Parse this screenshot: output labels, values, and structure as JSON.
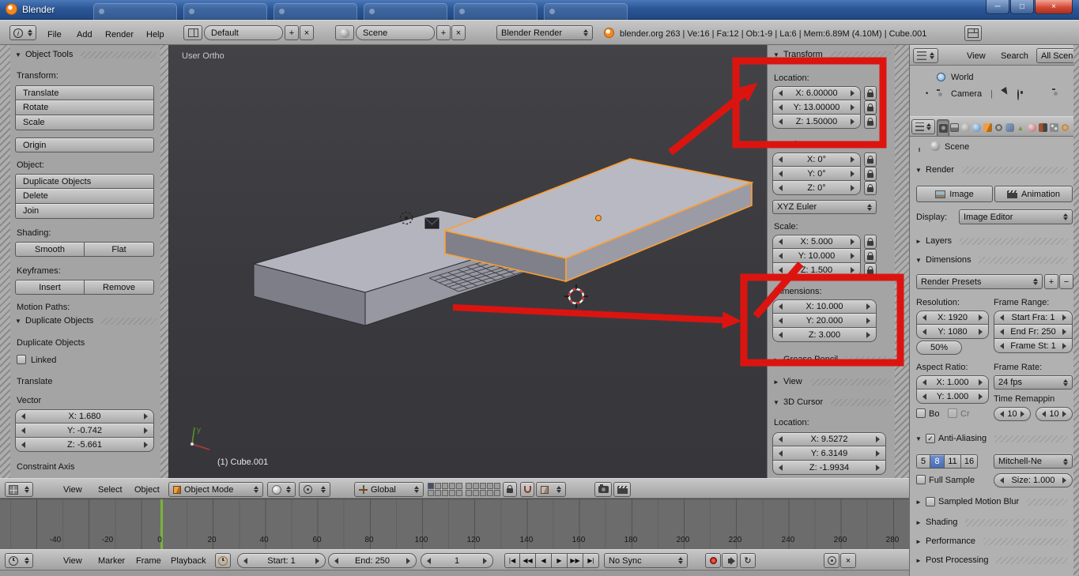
{
  "window": {
    "title": "Blender",
    "minimize": "─",
    "maximize": "□",
    "close": "×"
  },
  "info": {
    "menu_file": "File",
    "menu_add": "Add",
    "menu_render": "Render",
    "menu_help": "Help",
    "layout": "Default",
    "scene": "Scene",
    "engine": "Blender Render",
    "stats": "blender.org 263 | Ve:16 | Fa:12 | Ob:1-9 | La:6 | Mem:6.89M (4.10M) | Cube.001"
  },
  "tools": {
    "title": "Object Tools",
    "transform_label": "Transform:",
    "translate": "Translate",
    "rotate": "Rotate",
    "scale": "Scale",
    "origin": "Origin",
    "object_label": "Object:",
    "duplicate": "Duplicate Objects",
    "delete": "Delete",
    "join": "Join",
    "shading_label": "Shading:",
    "smooth": "Smooth",
    "flat": "Flat",
    "keyframes_label": "Keyframes:",
    "insert": "Insert",
    "remove": "Remove",
    "motion_paths_label": "Motion Paths:",
    "dup_panel_title": "Duplicate Objects",
    "dup_label": "Duplicate Objects",
    "linked": "Linked",
    "translate_label": "Translate",
    "vector_label": "Vector",
    "vx": "X: 1.680",
    "vy": "Y: -0.742",
    "vz": "Z: -5.661",
    "constraint_label": "Constraint Axis"
  },
  "viewport": {
    "view_label": "User Ortho",
    "object_name": "(1) Cube.001",
    "axis_y": "y"
  },
  "npanel": {
    "transform": "Transform",
    "location_label": "Location:",
    "loc": [
      "X: 6.00000",
      "Y: 13.00000",
      "Z: 1.50000"
    ],
    "rotation_label": "Rotation:",
    "rot": [
      "X: 0°",
      "Y: 0°",
      "Z: 0°"
    ],
    "rot_mode": "XYZ Euler",
    "scale_label": "Scale:",
    "scale": [
      "X: 5.000",
      "Y: 10.000",
      "Z: 1.500"
    ],
    "dim_label": "Dimensions:",
    "dim": [
      "X: 10.000",
      "Y: 20.000",
      "Z: 3.000"
    ],
    "grease": "Grease Pencil",
    "view": "View",
    "cursor": "3D Cursor",
    "cursor_loc_label": "Location:",
    "cur": [
      "X: 9.5272",
      "Y: 6.3149",
      "Z: -1.9934"
    ]
  },
  "outliner": {
    "view": "View",
    "search": "Search",
    "filter": "All Scene",
    "world": "World",
    "camera": "Camera"
  },
  "props": {
    "breadcrumb": "Scene",
    "render": "Render",
    "image": "Image",
    "animation": "Animation",
    "display_label": "Display:",
    "display": "Image Editor",
    "layers": "Layers",
    "dimensions": "Dimensions",
    "presets": "Render Presets",
    "resolution_label": "Resolution:",
    "res_x": "X: 1920",
    "res_y": "Y: 1080",
    "res_pct": "50%",
    "frame_range_label": "Frame Range:",
    "fr_start": "Start Fra: 1",
    "fr_end": "End Fr: 250",
    "fr_step": "Frame St: 1",
    "aspect_label": "Aspect Ratio:",
    "asp_x": "X: 1.000",
    "asp_y": "Y: 1.000",
    "frame_rate_label": "Frame Rate:",
    "fps": "24 fps",
    "time_remap_label": "Time Remappin",
    "border": "Bo",
    "crop": "Cr",
    "remap_old": "10",
    "remap_new": "10",
    "aa": "Anti-Aliasing",
    "s5": "5",
    "s8": "8",
    "s11": "11",
    "s16": "16",
    "aa_filter": "Mitchell-Ne",
    "full_sample": "Full Sample",
    "size": "Size: 1.000",
    "smb": "Sampled Motion Blur",
    "shading": "Shading",
    "performance": "Performance",
    "post": "Post Processing"
  },
  "v3d": {
    "view": "View",
    "select": "Select",
    "object": "Object",
    "mode": "Object Mode",
    "orientation": "Global"
  },
  "timeline": {
    "ticks": [
      "-40",
      "-20",
      "0",
      "20",
      "40",
      "60",
      "80",
      "100",
      "120",
      "140",
      "160",
      "180",
      "200",
      "220",
      "240",
      "260",
      "280"
    ],
    "view": "View",
    "marker": "Marker",
    "frame": "Frame",
    "playback": "Playback",
    "start": "Start: 1",
    "end": "End: 250",
    "current": "1",
    "sync": "No Sync"
  },
  "icons": {
    "collapse": "▼",
    "expand": "►",
    "check": "✓",
    "plus": "+",
    "minus": "−",
    "close": "×",
    "info": "i",
    "jump_start": "|◀",
    "rew": "◀◀",
    "play_rev": "◀",
    "play": "▶",
    "ff": "▶▶",
    "jump_end": "▶|",
    "refresh": "↻",
    "data_triangle": "▲",
    "dot": "•",
    "divider": "|"
  },
  "colors": {
    "annotation": "#dc1410",
    "selection": "#ff9e30",
    "frame_marker": "#79b33c",
    "titlebar_blue": "#2c5796",
    "active_sample": "#4f74b8"
  }
}
